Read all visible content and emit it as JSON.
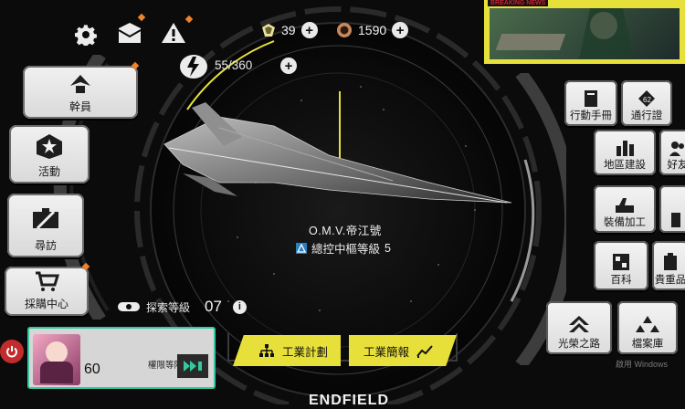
{
  "header": {
    "stamina": {
      "value": "55/360"
    },
    "currency_a": {
      "value": "39"
    },
    "currency_b": {
      "value": "1590"
    }
  },
  "left_menu": [
    {
      "label": "幹員"
    },
    {
      "label": "活動",
      "badge": "EVENT"
    },
    {
      "label": "尋訪"
    },
    {
      "label": "採購中心"
    }
  ],
  "exploration": {
    "label": "探索等級",
    "value": "07"
  },
  "player": {
    "level": "60",
    "rank_label": "權限等階"
  },
  "ship": {
    "name": "O.M.V.帝江號",
    "control_label": "總控中樞等級",
    "control_level": "5"
  },
  "bottom_tabs": {
    "plan": "工業計劃",
    "summary": "工業簡報"
  },
  "news": {
    "banner": "BREAKING NEWS"
  },
  "right_menu": [
    {
      "label": "行動手冊"
    },
    {
      "label": "通行證"
    },
    {
      "label": "地區建設"
    },
    {
      "label": "好友"
    },
    {
      "label": "裝備加工"
    },
    {
      "label": "百科"
    },
    {
      "label": "貴重品"
    },
    {
      "label": "光榮之路"
    },
    {
      "label": "檔案庫"
    }
  ],
  "footer": {
    "logo": "ENDFIELD",
    "watermark": "啟用 Windows"
  },
  "colors": {
    "accent_yellow": "#e8e03a",
    "accent_orange": "#f0822a",
    "tile_light": "#e6e6e6",
    "cyan": "#34c0d8"
  }
}
